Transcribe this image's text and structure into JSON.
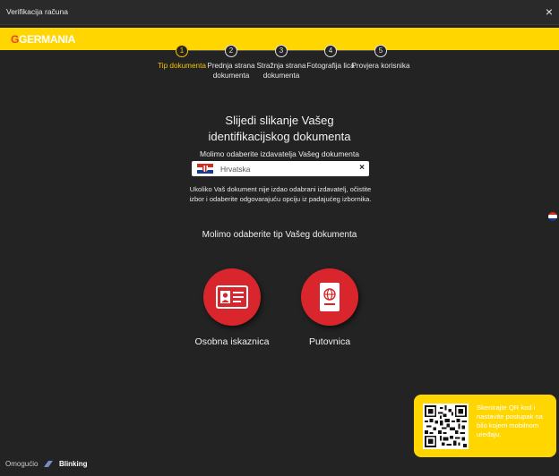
{
  "window": {
    "title": "Verifikacija računa",
    "close_icon": "×"
  },
  "brand": {
    "g": "G",
    "name": "GERMANIA",
    "accent": "#ffd600"
  },
  "steps": [
    {
      "num": "1",
      "label": "Tip dokumenta",
      "active": true
    },
    {
      "num": "2",
      "label": "Prednja strana dokumenta",
      "active": false
    },
    {
      "num": "3",
      "label": "Stražnja strana dokumenta",
      "active": false
    },
    {
      "num": "4",
      "label": "Fotografija lica",
      "active": false
    },
    {
      "num": "5",
      "label": "Provjera korisnika",
      "active": false
    }
  ],
  "main": {
    "heading_line1": "Slijedi slikanje Vašeg",
    "heading_line2": "identifikacijskog dokumenta",
    "issuer_prompt": "Molimo odaberite izdavatelja Vašeg dokumenta",
    "issuer_value": "Hrvatska",
    "clear_icon": "×",
    "info_text": "Ukoliko Vaš dokument nije izdao odabrani izdavatelj, očistite izbor i odaberite odgovarajuću opciju iz padajućeg izbornika.",
    "doc_type_prompt": "Molimo odaberite tip Vašeg dokumenta",
    "doc_types": [
      {
        "label": "Osobna iskaznica",
        "icon": "id-card-icon"
      },
      {
        "label": "Putovnica",
        "icon": "passport-icon"
      }
    ],
    "doc_button_color": "#d9262c"
  },
  "footer": {
    "powered_by": "Omogućio",
    "vendor": "Blinking"
  },
  "qr": {
    "text": "Skenirajte QR kod i nastavite postupak na bilo kojem mobilnom uređaju."
  }
}
